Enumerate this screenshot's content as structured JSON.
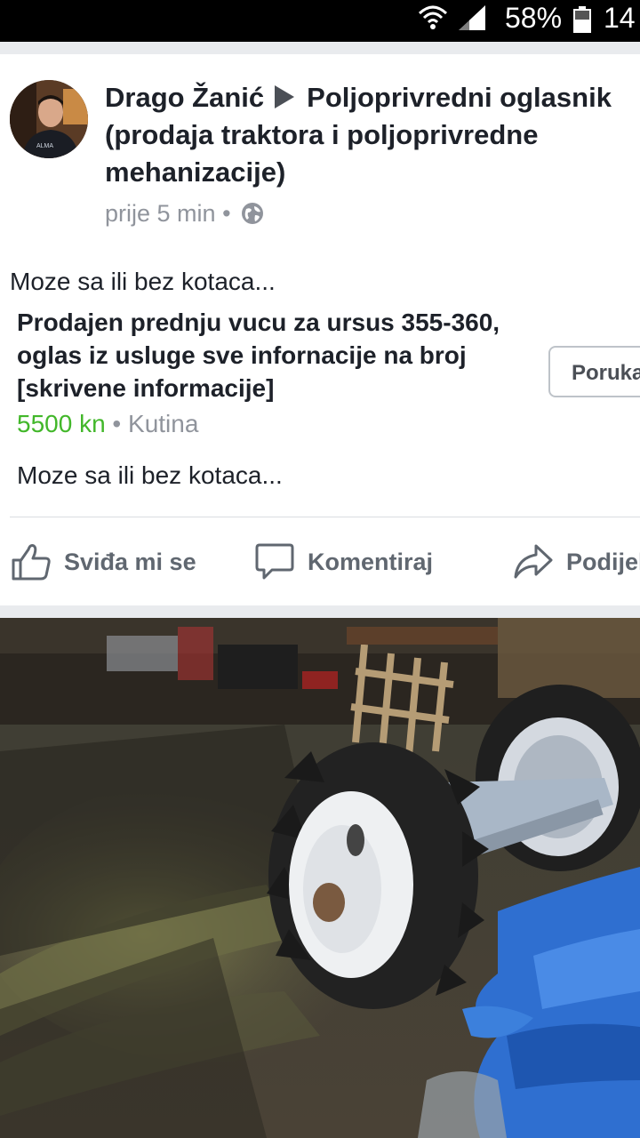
{
  "status_bar": {
    "battery_percent": "58%",
    "time": "14"
  },
  "post": {
    "author": "Drago Žanić",
    "group": "Poljoprivredni oglasnik (prodaja traktora i poljoprivredne mehanizacije)",
    "timestamp": "prije 5 min",
    "separator": "•",
    "privacy_icon": "globe-icon",
    "text": "Moze sa ili bez kotaca..."
  },
  "listing": {
    "title": "Prodajen prednju vucu za ursus 355-360, oglas iz usluge sve infornacije na broj [skrivene informacije]",
    "price": "5500 kn",
    "separator": "•",
    "location": "Kutina",
    "message_button": "Poruka",
    "description": "Moze sa ili bez kotaca..."
  },
  "actions": {
    "like": "Sviđa mi se",
    "comment": "Komentiraj",
    "share": "Podijeli"
  },
  "colors": {
    "price": "#42b72a",
    "text": "#1d2129",
    "secondary": "#90949c",
    "action": "#606770"
  }
}
